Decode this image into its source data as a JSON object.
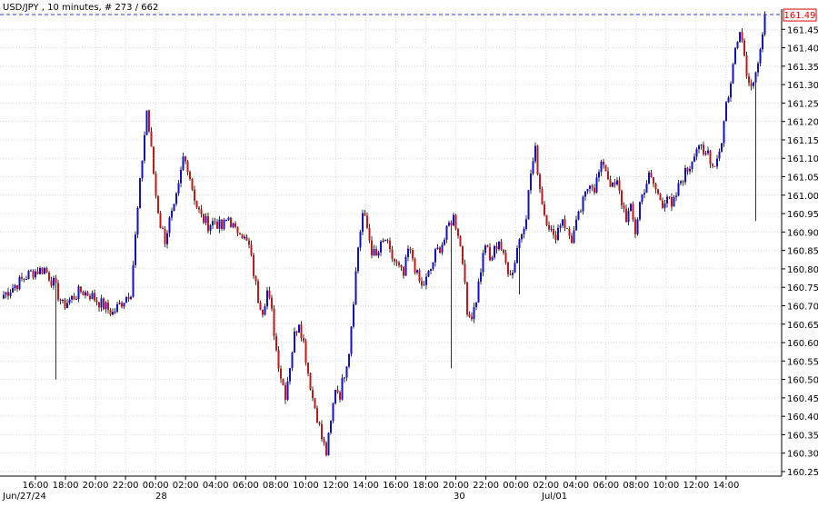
{
  "header": {
    "title": "USD/JPY , 10 minutes, # 273 / 662"
  },
  "colors": {
    "up_candle": "#1010c8",
    "down_candle": "#c01818",
    "wick": "#333333",
    "grid": "#d8d8d8",
    "last_price_line": "#3030ff",
    "last_price_box_text": "#e00000",
    "axis_text": "#000000"
  },
  "chart_data": {
    "type": "candlestick",
    "symbol": "USD/JPY",
    "timeframe": "10 minutes",
    "bar_counter": "# 273 / 662",
    "last_price": 161.49,
    "last_price_label": "161.49",
    "ylim": [
      160.25,
      161.5
    ],
    "y_ticks": [
      "161.45",
      "161.40",
      "161.35",
      "161.30",
      "161.25",
      "161.20",
      "161.15",
      "161.10",
      "161.05",
      "161.00",
      "160.95",
      "160.90",
      "160.85",
      "160.80",
      "160.75",
      "160.70",
      "160.65",
      "160.60",
      "160.55",
      "160.50",
      "160.45",
      "160.40",
      "160.35",
      "160.30",
      "160.25"
    ],
    "x_ticks": [
      "16:00",
      "18:00",
      "20:00",
      "22:00",
      "00:00",
      "02:00",
      "04:00",
      "06:00",
      "08:00",
      "10:00",
      "12:00",
      "14:00",
      "16:00",
      "18:00",
      "20:00",
      "22:00",
      "00:00",
      "02:00",
      "04:00",
      "06:00",
      "08:00",
      "10:00",
      "12:00",
      "14:00"
    ],
    "date_labels": [
      "Jun/27/24",
      "28",
      "30",
      "Jul/01"
    ],
    "grid": true,
    "close_path": [
      [
        0,
        160.73
      ],
      [
        4,
        160.75
      ],
      [
        8,
        160.77
      ],
      [
        12,
        160.79
      ],
      [
        18,
        160.8
      ],
      [
        22,
        160.76
      ],
      [
        26,
        160.7
      ],
      [
        30,
        160.72
      ],
      [
        34,
        160.74
      ],
      [
        38,
        160.73
      ],
      [
        44,
        160.7
      ],
      [
        48,
        160.68
      ],
      [
        52,
        160.71
      ],
      [
        56,
        160.74
      ],
      [
        59,
        160.96
      ],
      [
        61,
        161.1
      ],
      [
        63,
        161.23
      ],
      [
        65,
        161.12
      ],
      [
        67,
        161.0
      ],
      [
        69,
        160.92
      ],
      [
        71,
        160.88
      ],
      [
        73,
        160.93
      ],
      [
        75,
        160.96
      ],
      [
        77,
        161.02
      ],
      [
        79,
        161.1
      ],
      [
        81,
        161.08
      ],
      [
        83,
        161.02
      ],
      [
        85,
        160.97
      ],
      [
        87,
        160.94
      ],
      [
        90,
        160.92
      ],
      [
        93,
        160.93
      ],
      [
        96,
        160.91
      ],
      [
        99,
        160.94
      ],
      [
        102,
        160.9
      ],
      [
        104,
        160.91
      ],
      [
        106,
        160.88
      ],
      [
        108,
        160.86
      ],
      [
        110,
        160.79
      ],
      [
        112,
        160.72
      ],
      [
        114,
        160.69
      ],
      [
        116,
        160.74
      ],
      [
        118,
        160.68
      ],
      [
        120,
        160.58
      ],
      [
        122,
        160.51
      ],
      [
        124,
        160.46
      ],
      [
        126,
        160.54
      ],
      [
        128,
        160.62
      ],
      [
        130,
        160.66
      ],
      [
        132,
        160.6
      ],
      [
        134,
        160.52
      ],
      [
        136,
        160.45
      ],
      [
        138,
        160.4
      ],
      [
        140,
        160.34
      ],
      [
        142,
        160.3
      ],
      [
        144,
        160.38
      ],
      [
        146,
        160.48
      ],
      [
        148,
        160.46
      ],
      [
        150,
        160.52
      ],
      [
        152,
        160.58
      ],
      [
        154,
        160.72
      ],
      [
        156,
        160.86
      ],
      [
        158,
        160.95
      ],
      [
        160,
        160.91
      ],
      [
        162,
        160.85
      ],
      [
        164,
        160.83
      ],
      [
        166,
        160.86
      ],
      [
        168,
        160.88
      ],
      [
        170,
        160.84
      ],
      [
        172,
        160.82
      ],
      [
        174,
        160.8
      ],
      [
        176,
        160.78
      ],
      [
        178,
        160.85
      ],
      [
        180,
        160.83
      ],
      [
        182,
        160.78
      ],
      [
        184,
        160.75
      ],
      [
        186,
        160.77
      ],
      [
        188,
        160.8
      ],
      [
        190,
        160.84
      ],
      [
        192,
        160.86
      ],
      [
        194,
        160.88
      ],
      [
        196,
        160.92
      ],
      [
        198,
        160.94
      ],
      [
        200,
        160.9
      ],
      [
        202,
        160.82
      ],
      [
        203,
        160.78
      ],
      [
        204,
        160.66
      ],
      [
        206,
        160.68
      ],
      [
        208,
        160.72
      ],
      [
        210,
        160.8
      ],
      [
        212,
        160.87
      ],
      [
        214,
        160.82
      ],
      [
        216,
        160.85
      ],
      [
        218,
        160.88
      ],
      [
        220,
        160.83
      ],
      [
        222,
        160.8
      ],
      [
        224,
        160.79
      ],
      [
        226,
        160.86
      ],
      [
        228,
        160.9
      ],
      [
        230,
        160.95
      ],
      [
        232,
        161.06
      ],
      [
        234,
        161.12
      ],
      [
        236,
        161.02
      ],
      [
        238,
        160.95
      ],
      [
        240,
        160.92
      ],
      [
        242,
        160.88
      ],
      [
        244,
        160.91
      ],
      [
        246,
        160.94
      ],
      [
        248,
        160.9
      ],
      [
        250,
        160.88
      ],
      [
        252,
        160.92
      ],
      [
        254,
        160.96
      ],
      [
        256,
        161.0
      ],
      [
        258,
        161.04
      ],
      [
        260,
        161.02
      ],
      [
        262,
        161.06
      ],
      [
        264,
        161.09
      ],
      [
        266,
        161.05
      ],
      [
        268,
        161.02
      ],
      [
        270,
        161.03
      ],
      [
        272,
        160.98
      ],
      [
        274,
        160.94
      ],
      [
        276,
        160.96
      ],
      [
        278,
        160.9
      ],
      [
        280,
        160.98
      ],
      [
        282,
        161.02
      ],
      [
        284,
        161.05
      ],
      [
        286,
        161.03
      ],
      [
        288,
        161.0
      ],
      [
        290,
        160.98
      ],
      [
        292,
        161.0
      ],
      [
        294,
        160.96
      ],
      [
        296,
        161.0
      ],
      [
        298,
        161.04
      ],
      [
        300,
        161.06
      ],
      [
        302,
        161.08
      ],
      [
        304,
        161.12
      ],
      [
        306,
        161.14
      ],
      [
        308,
        161.1
      ],
      [
        310,
        161.12
      ],
      [
        312,
        161.08
      ],
      [
        314,
        161.1
      ],
      [
        316,
        161.15
      ],
      [
        318,
        161.25
      ],
      [
        320,
        161.3
      ],
      [
        322,
        161.4
      ],
      [
        324,
        161.46
      ],
      [
        326,
        161.38
      ],
      [
        328,
        161.3
      ],
      [
        330,
        161.32
      ],
      [
        332,
        161.36
      ],
      [
        334,
        161.42
      ],
      [
        335,
        161.49
      ]
    ],
    "spike_wicks": [
      [
        23,
        160.5,
        160.72
      ],
      [
        197,
        160.53,
        160.68
      ],
      [
        227,
        160.73,
        160.88
      ],
      [
        331,
        160.93,
        161.3
      ]
    ]
  }
}
